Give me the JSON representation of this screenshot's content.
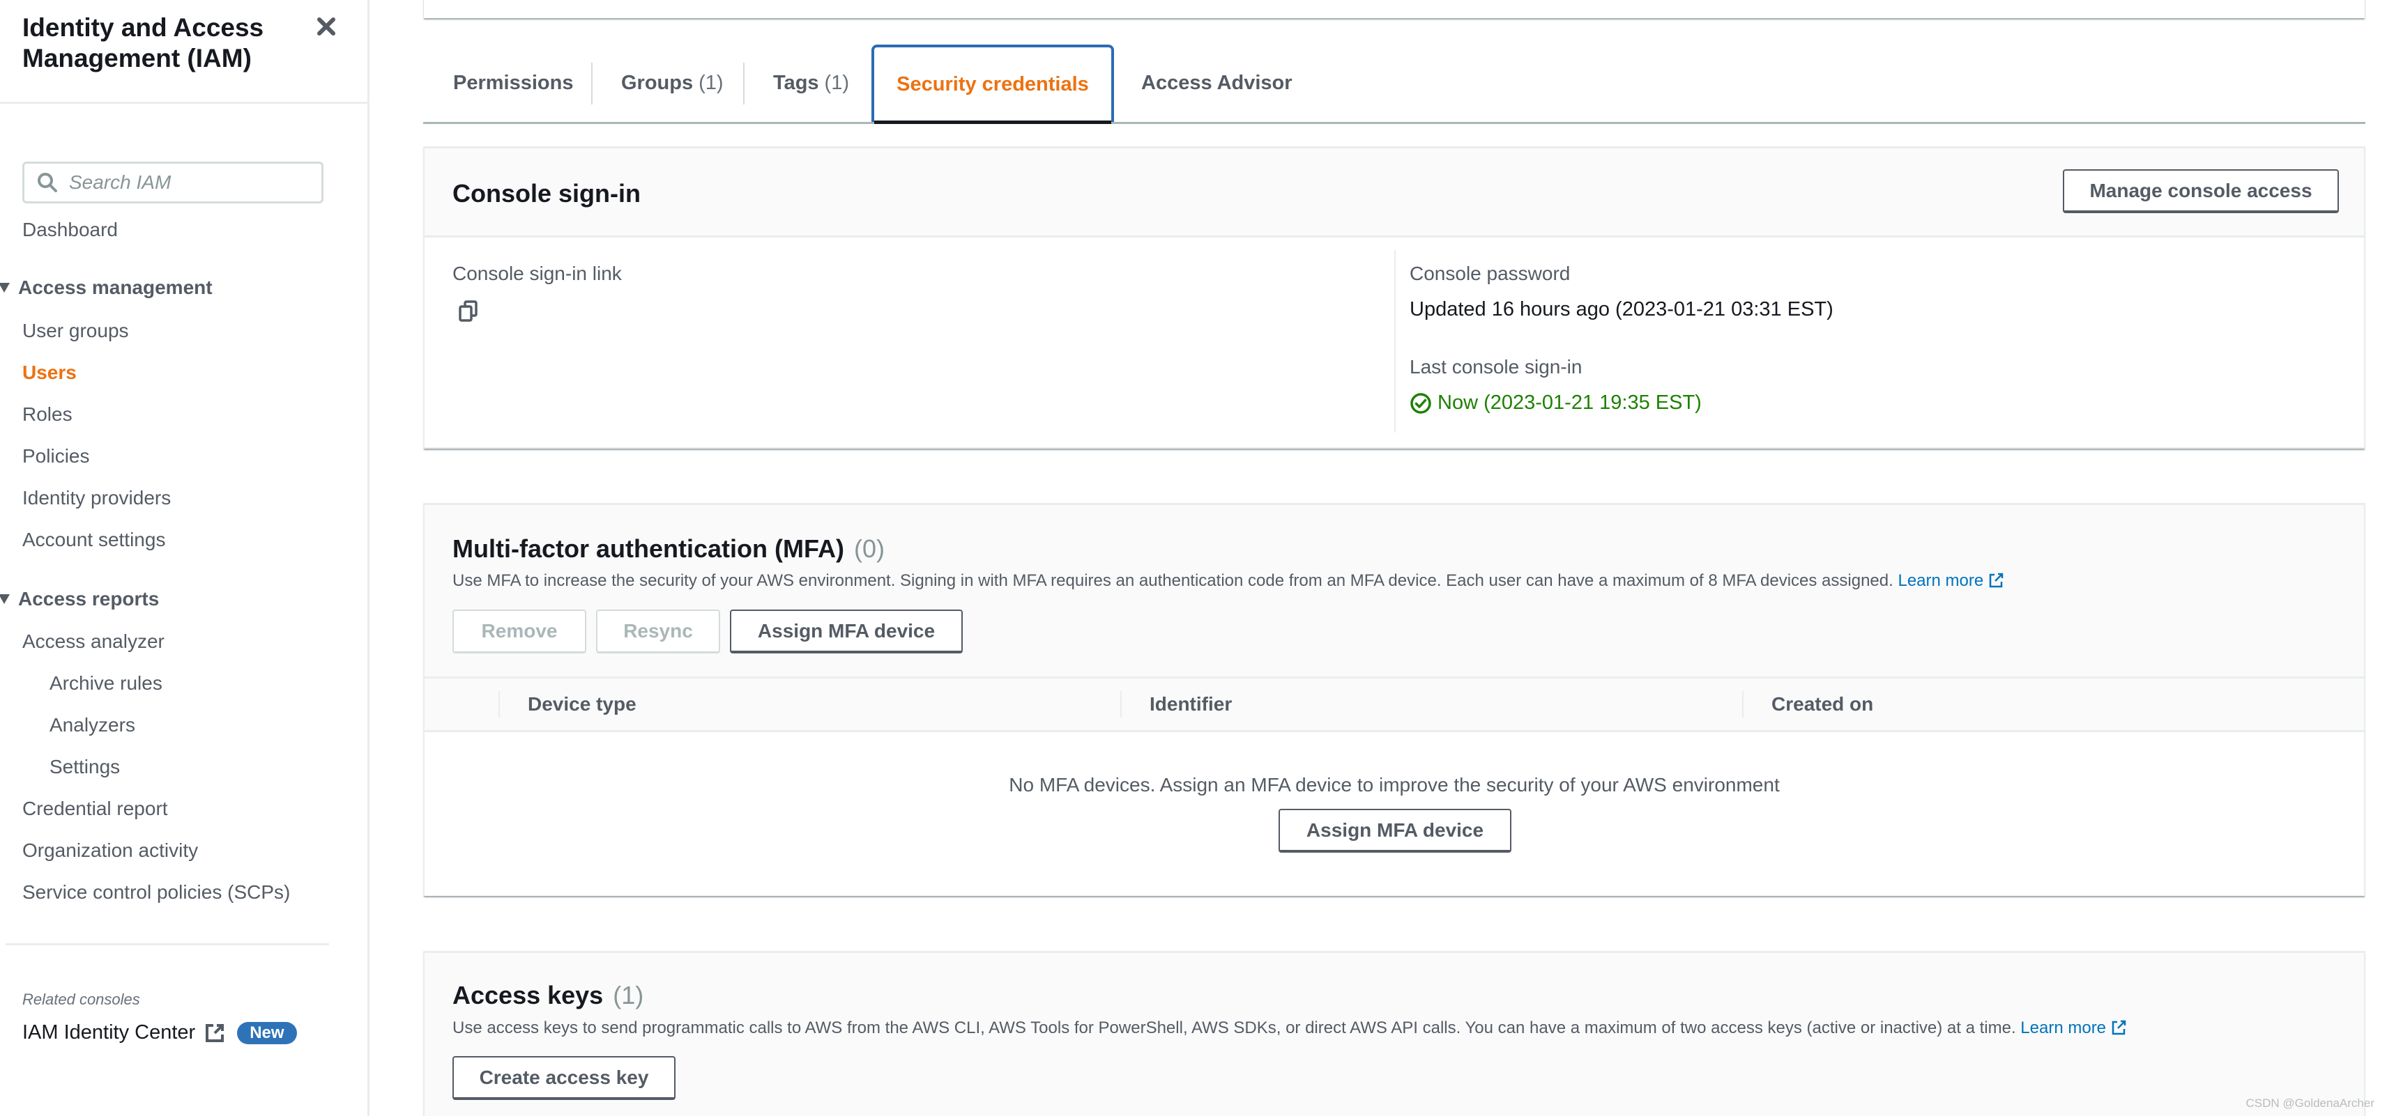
{
  "sidebar": {
    "title": "Identity and Access Management (IAM)",
    "close_icon": "close-icon",
    "search": {
      "placeholder": "Search IAM",
      "value": "",
      "icon": "search-icon"
    },
    "dashboard": "Dashboard",
    "sections": [
      {
        "label": "Access management",
        "expanded": true,
        "items": [
          {
            "label": "User groups",
            "active": false
          },
          {
            "label": "Users",
            "active": true
          },
          {
            "label": "Roles",
            "active": false
          },
          {
            "label": "Policies",
            "active": false
          },
          {
            "label": "Identity providers",
            "active": false
          },
          {
            "label": "Account settings",
            "active": false
          }
        ]
      },
      {
        "label": "Access reports",
        "expanded": true,
        "items": [
          {
            "label": "Access analyzer",
            "active": false
          },
          {
            "label": "Archive rules",
            "active": false,
            "sub": true
          },
          {
            "label": "Analyzers",
            "active": false,
            "sub": true
          },
          {
            "label": "Settings",
            "active": false,
            "sub": true
          },
          {
            "label": "Credential report",
            "active": false
          },
          {
            "label": "Organization activity",
            "active": false
          },
          {
            "label": "Service control policies (SCPs)",
            "active": false
          }
        ]
      }
    ],
    "related": {
      "label": "Related consoles",
      "link_label": "IAM Identity Center",
      "link_icon": "external-link-icon",
      "badge": "New"
    }
  },
  "tabs": [
    {
      "label": "Permissions",
      "count": "",
      "active": false
    },
    {
      "label": "Groups",
      "count": "(1)",
      "active": false
    },
    {
      "label": "Tags",
      "count": "(1)",
      "active": false
    },
    {
      "label": "Security credentials",
      "count": "",
      "active": true
    },
    {
      "label": "Access Advisor",
      "count": "",
      "active": false
    }
  ],
  "console_signin": {
    "title": "Console sign-in",
    "manage_button": "Manage console access",
    "link_label": "Console sign-in link",
    "copy_icon": "copy-icon",
    "password_label": "Console password",
    "password_value": "Updated 16 hours ago (2023-01-21 03:31 EST)",
    "last_signin_label": "Last console sign-in",
    "last_signin_value": "Now (2023-01-21 19:35 EST)",
    "last_signin_icon": "check-circle-icon"
  },
  "mfa": {
    "title": "Multi-factor authentication (MFA)",
    "count": "(0)",
    "description": "Use MFA to increase the security of your AWS environment. Signing in with MFA requires an authentication code from an MFA device. Each user can have a maximum of 8 MFA devices assigned.",
    "learn_more": "Learn more",
    "buttons": {
      "remove": "Remove",
      "resync": "Resync",
      "assign": "Assign MFA device"
    },
    "table": {
      "columns": [
        "Device type",
        "Identifier",
        "Created on"
      ],
      "rows": [],
      "empty_text": "No MFA devices. Assign an MFA device to improve the security of your AWS environment",
      "empty_button": "Assign MFA device"
    }
  },
  "access_keys": {
    "title": "Access keys",
    "count": "(1)",
    "description": "Use access keys to send programmatic calls to AWS from the AWS CLI, AWS Tools for PowerShell, AWS SDKs, or direct AWS API calls. You can have a maximum of two access keys (active or inactive) at a time.",
    "learn_more": "Learn more",
    "create_button": "Create access key"
  },
  "watermark": "CSDN @GoldenaArcher",
  "colors": {
    "accent_orange": "#ec7211",
    "link_blue": "#0073bb",
    "success_green": "#1d8102",
    "badge_blue": "#2e73b8",
    "tab_focus_blue": "#2b6cb3"
  }
}
